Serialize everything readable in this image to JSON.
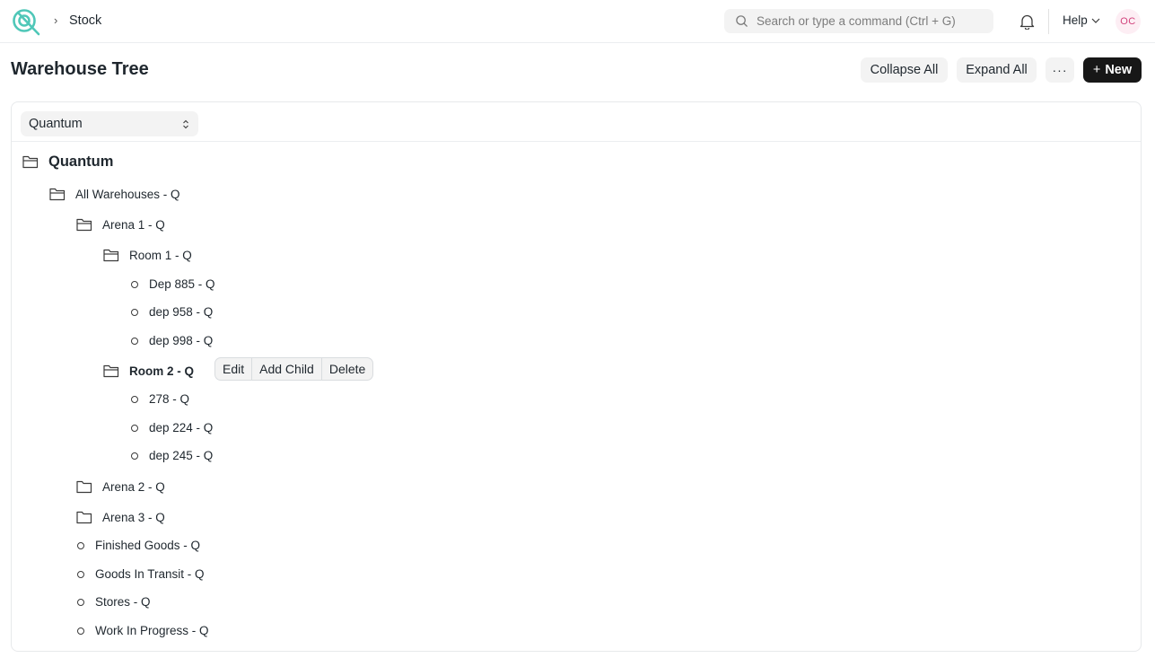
{
  "navbar": {
    "breadcrumb": "Stock",
    "search_placeholder": "Search or type a command (Ctrl + G)",
    "help_label": "Help",
    "avatar_initials": "OC"
  },
  "page": {
    "title": "Warehouse Tree",
    "collapse_all": "Collapse All",
    "expand_all": "Expand All",
    "more": "···",
    "new_label": "New"
  },
  "filter": {
    "company": "Quantum"
  },
  "tree": {
    "root": "Quantum",
    "all_warehouses": "All Warehouses - Q",
    "arena1": "Arena 1 - Q",
    "room1": "Room 1 - Q",
    "dep885": "Dep 885 - Q",
    "dep958": "dep 958 - Q",
    "dep998": "dep 998 - Q",
    "room2": "Room 2 - Q",
    "n278": "278 - Q",
    "dep224": "dep 224 - Q",
    "dep245": "dep 245 - Q",
    "arena2": "Arena 2 - Q",
    "arena3": "Arena 3 - Q",
    "finished_goods": "Finished Goods - Q",
    "goods_in_transit": "Goods In Transit - Q",
    "stores": "Stores - Q",
    "work_in_progress": "Work In Progress - Q"
  },
  "node_actions": {
    "edit": "Edit",
    "add_child": "Add Child",
    "delete": "Delete"
  },
  "colors": {
    "logo": "#4fc7b8",
    "primary_button": "#171717",
    "avatar_text": "#d2447d"
  }
}
